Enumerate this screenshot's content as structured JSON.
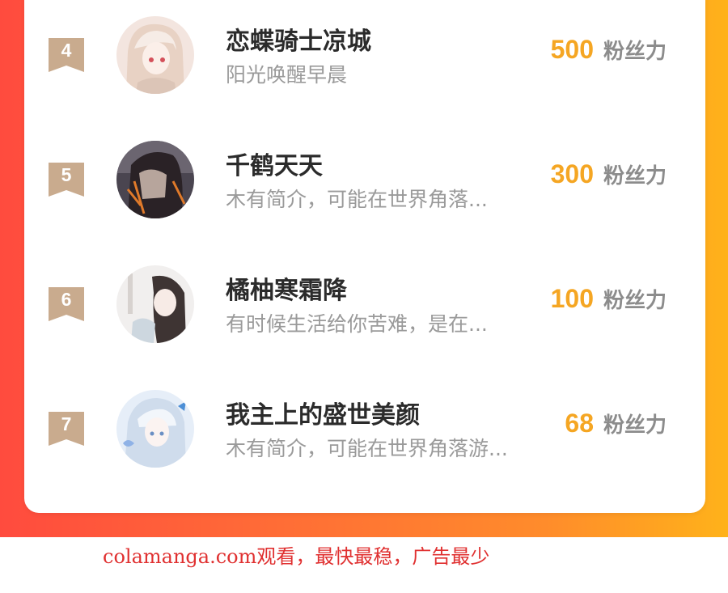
{
  "ranking": {
    "items": [
      {
        "rank": "4",
        "name": "恋蝶骑士凉城",
        "desc": "阳光唤醒早晨",
        "score": "500",
        "unit": "粉丝力"
      },
      {
        "rank": "5",
        "name": "千鹤天天",
        "desc": "木有简介，可能在世界角落...",
        "score": "300",
        "unit": "粉丝力"
      },
      {
        "rank": "6",
        "name": "橘柚寒霜降",
        "desc": "有时候生活给你苦难，是在...",
        "score": "100",
        "unit": "粉丝力"
      },
      {
        "rank": "7",
        "name": "我主上的盛世美颜",
        "desc": "木有简介，可能在世界角落游...",
        "score": "68",
        "unit": "粉丝力"
      }
    ]
  },
  "footer": {
    "watermark": "colamanga.com观看，最快最稳，广告最少"
  },
  "colors": {
    "accent": "#f5a623",
    "rank_badge": "#c9ab8e",
    "bg_gradient_start": "#ff4b3e",
    "bg_gradient_end": "#ffb21a"
  }
}
